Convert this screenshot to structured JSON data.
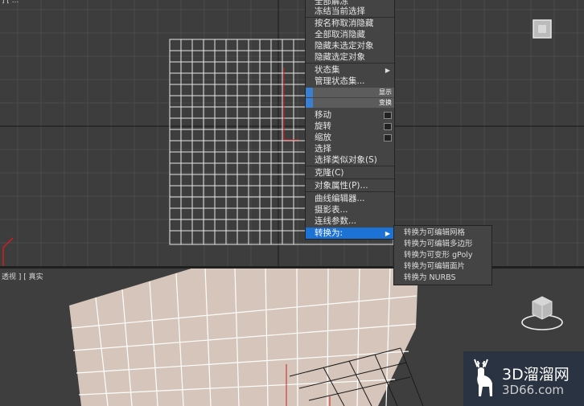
{
  "quad_menu": {
    "items": [
      {
        "label": "全部解冻"
      },
      {
        "label": "冻结当前选择"
      },
      {
        "label": "按名称取消隐藏"
      },
      {
        "label": "全部取消隐藏"
      },
      {
        "label": "隐藏未选定对象"
      },
      {
        "label": "隐藏选定对象"
      },
      {
        "label": "状态集"
      },
      {
        "label": "管理状态集..."
      },
      {
        "label": "移动"
      },
      {
        "label": "旋转"
      },
      {
        "label": "缩放"
      },
      {
        "label": "选择"
      },
      {
        "label": "选择类似对象(S)"
      },
      {
        "label": "克隆(C)"
      },
      {
        "label": "对象属性(P)..."
      },
      {
        "label": "曲线编辑器..."
      },
      {
        "label": "摄影表..."
      },
      {
        "label": "连线参数..."
      },
      {
        "label": "转换为:"
      }
    ],
    "header_display": "显示",
    "header_transform": "变换"
  },
  "submenu": {
    "items": [
      {
        "label": "转换为可编辑网格"
      },
      {
        "label": "转换为可编辑多边形"
      },
      {
        "label": "转换为可变形 gPoly"
      },
      {
        "label": "转换为可编辑面片"
      },
      {
        "label": "转换为 NURBS"
      }
    ]
  },
  "viewport": {
    "persp_label": "透视 ] [ 真实",
    "top_corner_label": "] [ ..."
  },
  "watermark": {
    "line1": "3D溜溜网",
    "line2": "3D66.com"
  },
  "colors": {
    "selection": "#1d72d6",
    "menu_bg": "#444444",
    "plane": "#d6c5ba",
    "grid": "#4c4c4c"
  }
}
